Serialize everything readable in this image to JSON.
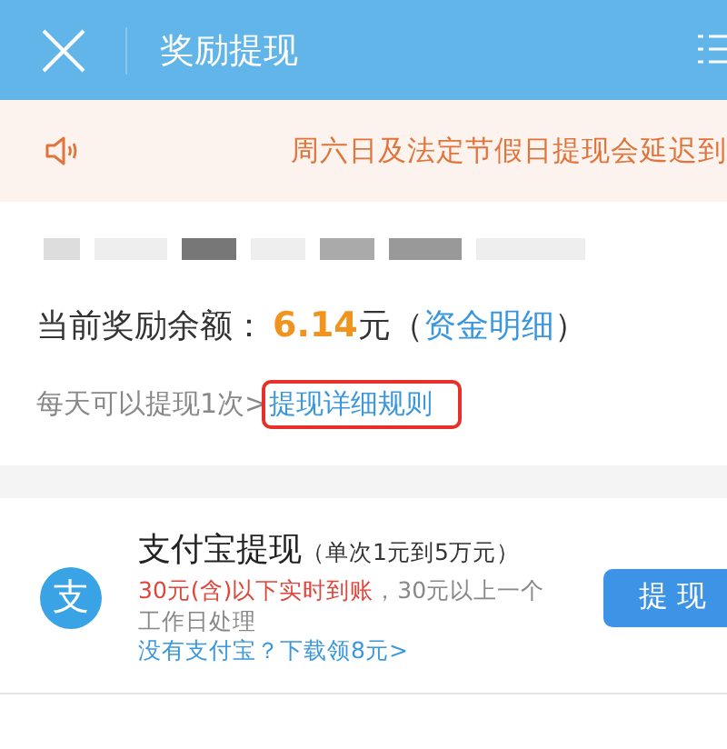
{
  "header": {
    "title": "奖励提现"
  },
  "notice": {
    "text": "周六日及法定节假日提现会延迟到"
  },
  "account": {
    "redacted": true
  },
  "balance": {
    "label": "当前奖励余额：",
    "amount": "6.14",
    "unit": "元",
    "open_paren": "（",
    "link": "资金明细",
    "close_paren": "）"
  },
  "limit": {
    "text": "每天可以提现1次>",
    "link": "提现详细规则",
    "highlighted": true
  },
  "methods": [
    {
      "logo_text": "支",
      "name": "支付宝提现",
      "range": "（单次1元到5万元）",
      "fast_note": "30元(含)以下实时到账",
      "slow_note": "，30元以上一个工作日处理",
      "download_link": "没有支付宝？下载领8元>",
      "button": "提 现"
    }
  ]
}
